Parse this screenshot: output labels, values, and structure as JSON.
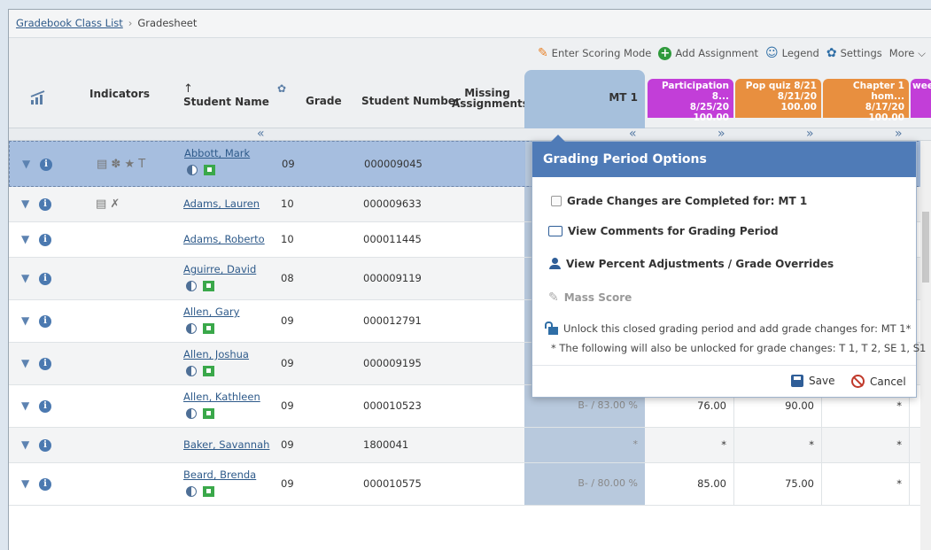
{
  "breadcrumb": {
    "link": "Gradebook Class List",
    "separator": "›",
    "current": "Gradesheet"
  },
  "toolbar": {
    "scoring_mode": "Enter Scoring Mode",
    "add_assignment": "Add Assignment",
    "legend": "Legend",
    "settings": "Settings",
    "more": "More"
  },
  "headers": {
    "indicators": "Indicators",
    "student_name": "Student Name",
    "grade": "Grade",
    "student_number": "Student Number",
    "missing_line1": "Missing",
    "missing_line2": "Assignments",
    "mt1": "MT 1"
  },
  "assignments": [
    {
      "title": "Participation 8...",
      "date": "8/25/20",
      "points": "100.00",
      "color": "#c23ed8"
    },
    {
      "title": "Pop quiz 8/21",
      "date": "8/21/20",
      "points": "100.00",
      "color": "#e88f3f"
    },
    {
      "title": "Chapter 1 hom...",
      "date": "8/17/20",
      "points": "100.00",
      "color": "#e88f3f"
    },
    {
      "title": "wee",
      "date": "",
      "points": "",
      "color": "#c23ed8"
    }
  ],
  "students": [
    {
      "name": "Abbott, Mark",
      "grade": "09",
      "number": "000009045",
      "indicators": "▤ ✽ ★ T",
      "icons": true,
      "mt1": "",
      "a1": "",
      "a2": "",
      "a3": ""
    },
    {
      "name": "Adams, Lauren",
      "grade": "10",
      "number": "000009633",
      "indicators": "▤ ✗",
      "icons": false,
      "mt1": "",
      "a1": "",
      "a2": "",
      "a3": ""
    },
    {
      "name": "Adams, Roberto",
      "grade": "10",
      "number": "000011445",
      "indicators": "",
      "icons": false,
      "mt1": "",
      "a1": "",
      "a2": "",
      "a3": ""
    },
    {
      "name": "Aguirre, David",
      "grade": "08",
      "number": "000009119",
      "indicators": "",
      "icons": true,
      "mt1": "",
      "a1": "",
      "a2": "",
      "a3": ""
    },
    {
      "name": "Allen, Gary",
      "grade": "09",
      "number": "000012791",
      "indicators": "",
      "icons": true,
      "mt1": "",
      "a1": "",
      "a2": "",
      "a3": ""
    },
    {
      "name": "Allen, Joshua",
      "grade": "09",
      "number": "000009195",
      "indicators": "",
      "icons": true,
      "mt1": "",
      "a1": "",
      "a2": "",
      "a3": ""
    },
    {
      "name": "Allen, Kathleen",
      "grade": "09",
      "number": "000010523",
      "indicators": "",
      "icons": true,
      "mt1": "B- / 83.00 %",
      "a1": "76.00",
      "a2": "90.00",
      "a3": "*"
    },
    {
      "name": "Baker, Savannah",
      "grade": "09",
      "number": "1800041",
      "indicators": "",
      "icons": false,
      "mt1": "*",
      "a1": "*",
      "a2": "*",
      "a3": "*"
    },
    {
      "name": "Beard, Brenda",
      "grade": "09",
      "number": "000010575",
      "indicators": "",
      "icons": true,
      "mt1": "B- / 80.00 %",
      "a1": "85.00",
      "a2": "75.00",
      "a3": "*"
    }
  ],
  "dialog": {
    "title": "Grading Period Options",
    "completed": "Grade Changes are Completed for: MT 1",
    "view_comments": "View Comments for Grading Period",
    "view_adjustments": "View Percent Adjustments / Grade Overrides",
    "mass_score": "Mass Score",
    "unlock": "Unlock this closed grading period and add grade changes for: MT 1*",
    "unlock_note": "* The following will also be unlocked for grade changes: T 1, T 2, SE 1, S1",
    "save": "Save",
    "cancel": "Cancel"
  }
}
